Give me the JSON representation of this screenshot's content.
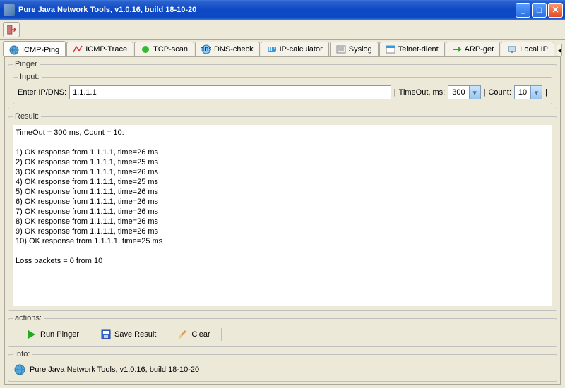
{
  "title": "Pure Java Network Tools,  v1.0.16, build 18-10-20",
  "tabs": [
    {
      "label": "ICMP-Ping",
      "active": true,
      "icon": "globe"
    },
    {
      "label": "ICMP-Trace",
      "active": false,
      "icon": "trace"
    },
    {
      "label": "TCP-scan",
      "active": false,
      "icon": "green"
    },
    {
      "label": "DNS-check",
      "active": false,
      "icon": "dns"
    },
    {
      "label": "IP-calculator",
      "active": false,
      "icon": "ip"
    },
    {
      "label": "Syslog",
      "active": false,
      "icon": "syslog"
    },
    {
      "label": "Telnet-dient",
      "active": false,
      "icon": "telnet"
    },
    {
      "label": "ARP-get",
      "active": false,
      "icon": "arp"
    },
    {
      "label": "Local IP",
      "active": false,
      "icon": "localip"
    }
  ],
  "pinger": {
    "legend": "Pinger",
    "input_legend": "Input:",
    "ip_label": "Enter IP/DNS:",
    "ip_value": "1.1.1.1",
    "timeout_label": "TimeOut, ms:",
    "timeout_value": "300",
    "count_label": "Count:",
    "count_value": "10"
  },
  "result": {
    "legend": "Result:",
    "header": "TimeOut = 300 ms, Count = 10:",
    "lines": [
      "1) OK response from 1.1.1.1, time=26 ms",
      "2) OK response from 1.1.1.1, time=25 ms",
      "3) OK response from 1.1.1.1, time=26 ms",
      "4) OK response from 1.1.1.1, time=25 ms",
      "5) OK response from 1.1.1.1, time=26 ms",
      "6) OK response from 1.1.1.1, time=26 ms",
      "7) OK response from 1.1.1.1, time=26 ms",
      "8) OK response from 1.1.1.1, time=26 ms",
      "9) OK response from 1.1.1.1, time=26 ms",
      "10) OK response from 1.1.1.1, time=25 ms"
    ],
    "summary": "Loss packets = 0 from 10"
  },
  "actions": {
    "legend": "actions:",
    "run": "Run Pinger",
    "save": "Save Result",
    "clear": "Clear"
  },
  "info": {
    "legend": "Info:",
    "text": "Pure Java Network Tools,  v1.0.16, build 18-10-20"
  }
}
